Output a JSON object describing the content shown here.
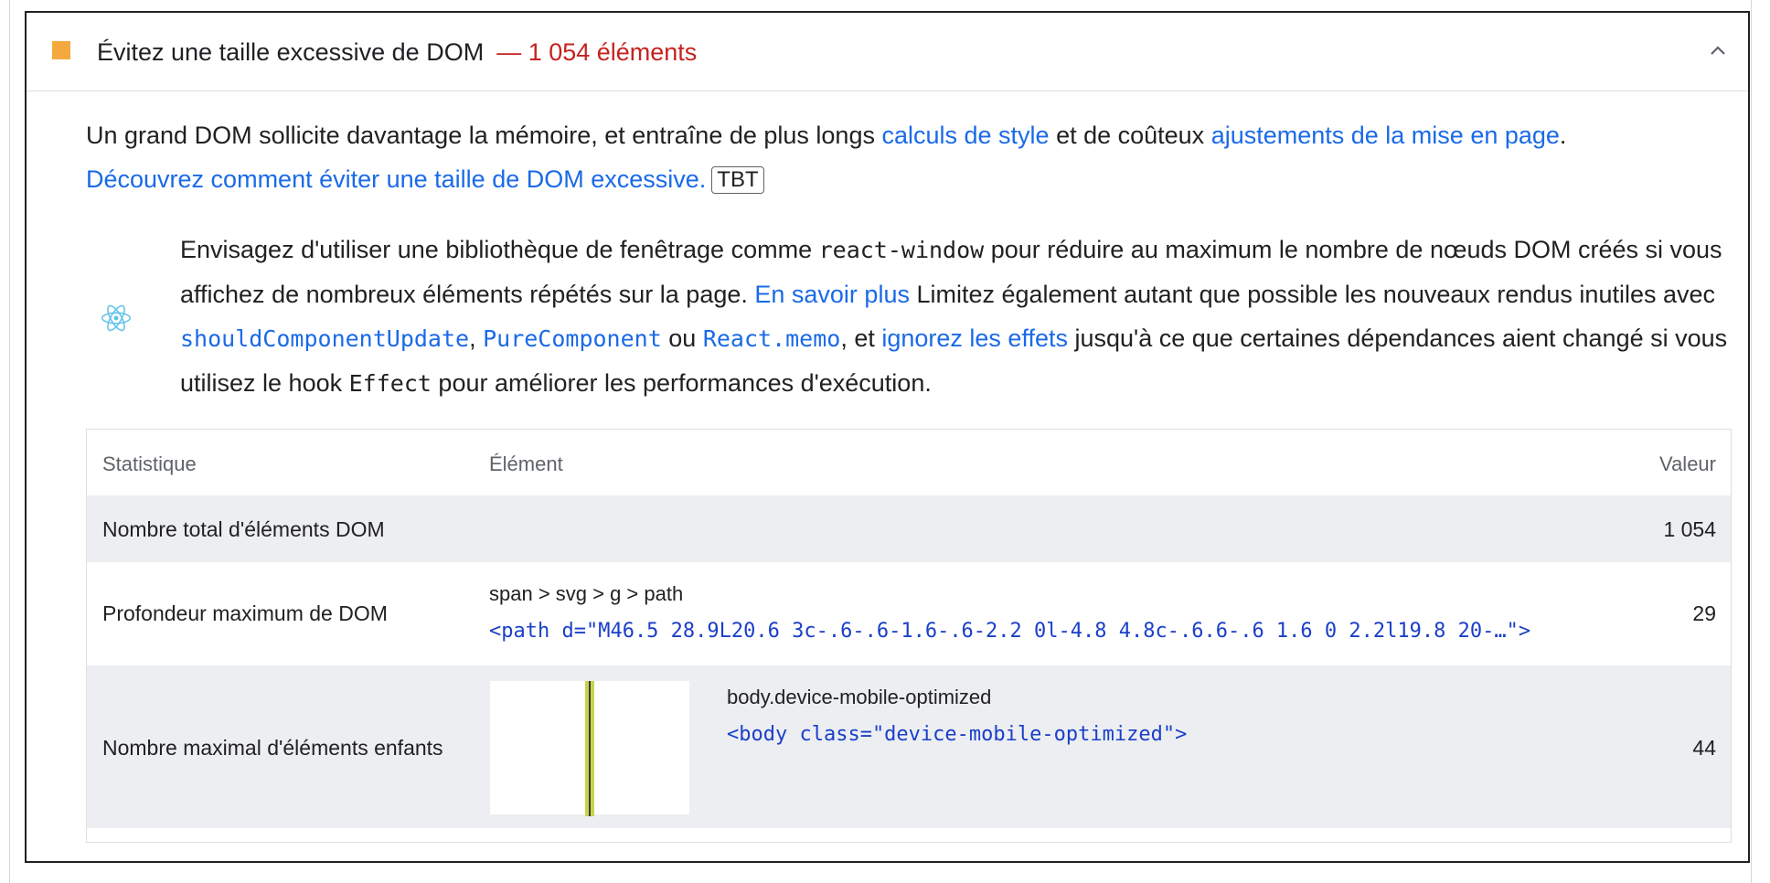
{
  "audit": {
    "title": "Évitez une taille excessive de DOM",
    "display_value": "— 1 054 éléments",
    "status_color": "#f4a93e",
    "chevron_icon": "chevron-up-icon"
  },
  "description": {
    "text_1": "Un grand DOM sollicite davantage la mémoire, et entraîne de plus longs ",
    "link_style": "calculs de style",
    "text_2": " et de coûteux ",
    "link_layout": "ajustements de la mise en page",
    "text_3": ".",
    "link_learn": "Découvrez comment éviter une taille de DOM excessive.",
    "badge": "TBT"
  },
  "stack_pack": {
    "icon": "react-icon",
    "t1": "Envisagez d'utiliser une bibliothèque de fenêtrage comme ",
    "code1": "react-window",
    "t2": " pour réduire au maximum le nombre de nœuds DOM créés si vous affichez de nombreux éléments répétés sur la page. ",
    "link1": "En savoir plus",
    "t3": " Limitez également autant que possible les nouveaux rendus inutiles avec ",
    "code2": "shouldComponentUpdate",
    "t4": ", ",
    "code3": "PureComponent",
    "t5": " ou ",
    "code4": "React.memo",
    "t6": ", et ",
    "link2": "ignorez les effets",
    "t7": " jusqu'à ce que certaines dépendances aient changé si vous utilisez le hook ",
    "code5": "Effect",
    "t8": " pour améliorer les performances d'exécution."
  },
  "table": {
    "headers": [
      "Statistique",
      "Élément",
      "Valeur"
    ],
    "rows": [
      {
        "stat": "Nombre total d'éléments DOM",
        "value": "1 054"
      },
      {
        "stat": "Profondeur maximum de DOM",
        "selector": "span > svg > g > path",
        "snippet": "<path d=\"M46.5 28.9L20.6 3c-.6-.6-1.6-.6-2.2 0l-4.8 4.8c-.6.6-.6 1.6 0 2.2l19.8 20-…\">",
        "value": "29"
      },
      {
        "stat": "Nombre maximal d'éléments enfants",
        "selector": "body.device-mobile-optimized",
        "snippet": "<body class=\"device-mobile-optimized\">",
        "value": "44"
      }
    ]
  }
}
